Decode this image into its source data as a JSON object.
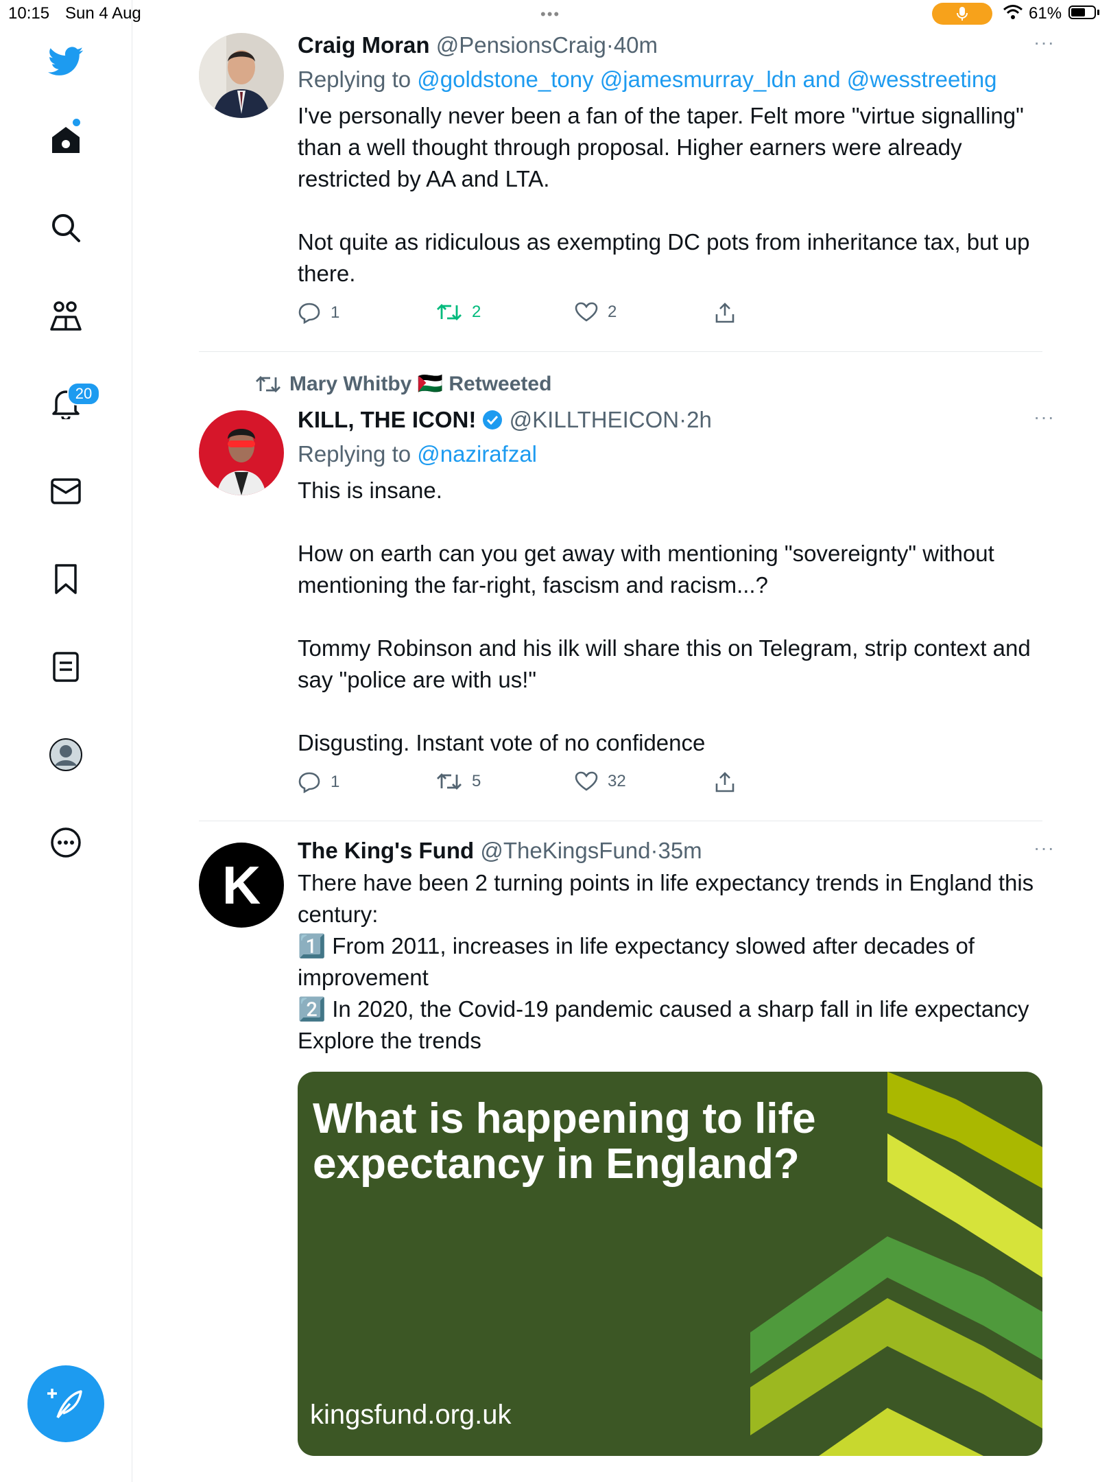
{
  "status_bar": {
    "time": "10:15",
    "date": "Sun 4 Aug",
    "battery": "61%",
    "battery_level": 0.61,
    "dots": "•••"
  },
  "sidebar": {
    "items": [
      {
        "name": "home"
      },
      {
        "name": "search"
      },
      {
        "name": "communities"
      },
      {
        "name": "notifications",
        "badge": "20"
      },
      {
        "name": "messages"
      },
      {
        "name": "bookmarks"
      },
      {
        "name": "lists"
      },
      {
        "name": "profile"
      },
      {
        "name": "more"
      }
    ],
    "accent": "#1d9bf0"
  },
  "tweets": [
    {
      "name": "Craig Moran",
      "handle": "@PensionsCraig",
      "sep": "·",
      "time": "40m",
      "replying_prefix": "Replying to",
      "replying_to": "@goldstone_tony @jamesmurray_ldn and @wesstreeting",
      "text": "I've personally never been a fan of the taper. Felt more \"virtue signalling\" than a well thought through proposal. Higher earners were already restricted by AA and LTA.\n\nNot quite as ridiculous as exempting DC pots from inheritance tax, but up there.",
      "replies": "1",
      "retweets": "2",
      "likes": "2",
      "more": "···"
    },
    {
      "retweeted_by": "Mary Whitby 🇵🇸 Retweeted",
      "name": "KILL, THE ICON!",
      "verified": true,
      "handle": "@KILLTHEICON",
      "sep": "·",
      "time": "2h",
      "replying_prefix": "Replying to",
      "replying_to": "@nazirafzal",
      "text": "This is insane.\n\nHow on earth can you get away with mentioning \"sovereignty\" without mentioning the far-right, fascism and racism...?\n\nTommy Robinson and his ilk will share this on Telegram, strip context and say \"police are with us!\"\n\nDisgusting. Instant vote of no confidence",
      "replies": "1",
      "retweets": "5",
      "likes": "32",
      "more": "···"
    },
    {
      "name": "The King's Fund",
      "handle": "@TheKingsFund",
      "sep": "·",
      "time": "35m",
      "avatar_letter": "K",
      "text": "There have been 2 turning points in life expectancy trends in England this century:\n1️⃣ From 2011, increases in life expectancy slowed after decades of improvement\n2️⃣ In 2020, the Covid-19 pandemic caused a sharp fall in life expectancy\nExplore the trends",
      "card": {
        "title": "What is happening to life expectancy in England?",
        "url": "kingsfund.org.uk"
      },
      "more": "···"
    }
  ]
}
